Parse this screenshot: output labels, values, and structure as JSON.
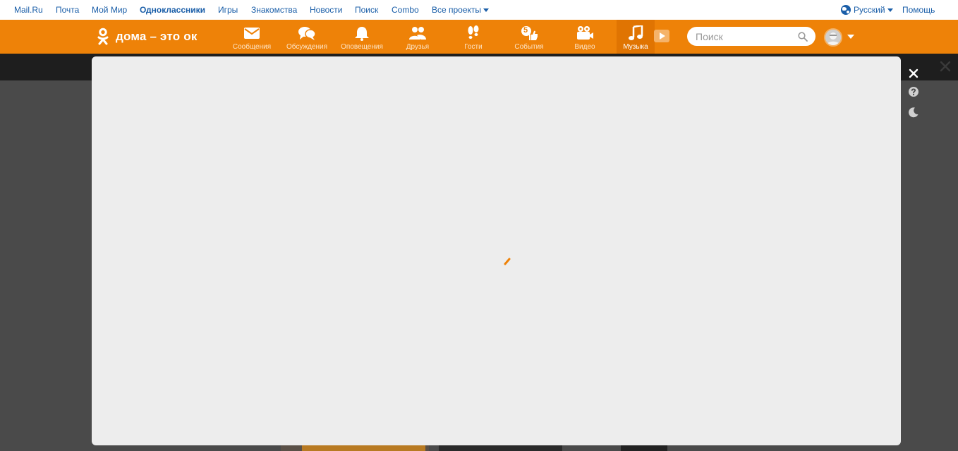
{
  "portal": {
    "links": [
      {
        "label": "Mail.Ru"
      },
      {
        "label": "Почта"
      },
      {
        "label": "Мой Мир"
      },
      {
        "label": "Одноклассники"
      },
      {
        "label": "Игры"
      },
      {
        "label": "Знакомства"
      },
      {
        "label": "Новости"
      },
      {
        "label": "Поиск"
      },
      {
        "label": "Combo"
      },
      {
        "label": "Все проекты"
      }
    ],
    "language": "Русский",
    "help": "Помощь"
  },
  "toolbar": {
    "logo_text": "дома – это ок",
    "nav": [
      {
        "label": "Сообщения",
        "icon": "envelope-icon"
      },
      {
        "label": "Обсуждения",
        "icon": "chat-bubbles-icon"
      },
      {
        "label": "Оповещения",
        "icon": "bell-icon"
      },
      {
        "label": "Друзья",
        "icon": "friends-icon"
      },
      {
        "label": "Гости",
        "icon": "footprints-icon"
      },
      {
        "label": "События",
        "icon": "thumbs-up-icon",
        "badge": "5"
      },
      {
        "label": "Видео",
        "icon": "video-camera-icon"
      },
      {
        "label": "Музыка",
        "icon": "music-note-icon",
        "active": true
      }
    ],
    "search_placeholder": "Поиск"
  },
  "colors": {
    "brand_orange": "#ee8208",
    "link_blue": "#1a5ea8",
    "modal_bg": "#ededed",
    "overlay": "#4a4a4a"
  },
  "modal": {
    "state": "loading"
  }
}
